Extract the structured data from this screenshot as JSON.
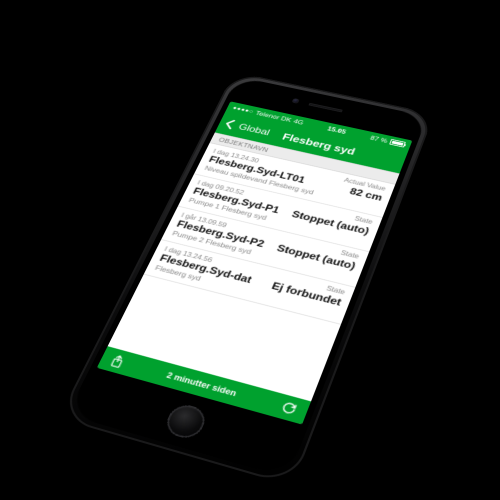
{
  "status": {
    "carrier": "Telenor DK",
    "network": "4G",
    "time": "15.05",
    "battery_pct": "87 %"
  },
  "nav": {
    "back_label": "Global",
    "title": "Flesberg syd"
  },
  "section_header": "OBJEKTNAVN",
  "value_header_default": "Actual Value",
  "state_header": "State",
  "rows": [
    {
      "timestamp": "I dag 13.24.30",
      "name": "Flesberg.Syd-LT01",
      "value": "82 cm",
      "value_header": "Actual Value",
      "subtitle": "Niveau spildevand Flesberg syd"
    },
    {
      "timestamp": "I dag 09.20.52",
      "name": "Flesberg.Syd-P1",
      "value": "Stoppet (auto)",
      "value_header": "State",
      "subtitle": "Pumpe 1 Flesberg syd"
    },
    {
      "timestamp": "I går 13.09.59",
      "name": "Flesberg.Syd-P2",
      "value": "Stoppet (auto)",
      "value_header": "State",
      "subtitle": "Pumpe 2 Flesberg syd"
    },
    {
      "timestamp": "I dag 13.24.56",
      "name": "Flesberg.Syd-dat",
      "value": "Ej forbundet",
      "value_header": "State",
      "subtitle": "Flesberg syd"
    }
  ],
  "footer": {
    "updated_label": "2 minutter siden"
  },
  "icons": {
    "back": "chevron-left-icon",
    "share": "share-icon",
    "refresh": "refresh-icon",
    "signal": "signal-dots-icon",
    "battery": "battery-icon"
  },
  "colors": {
    "brand": "#00a12e",
    "bg": "#f3f3f3",
    "muted": "#8a8a8a"
  }
}
